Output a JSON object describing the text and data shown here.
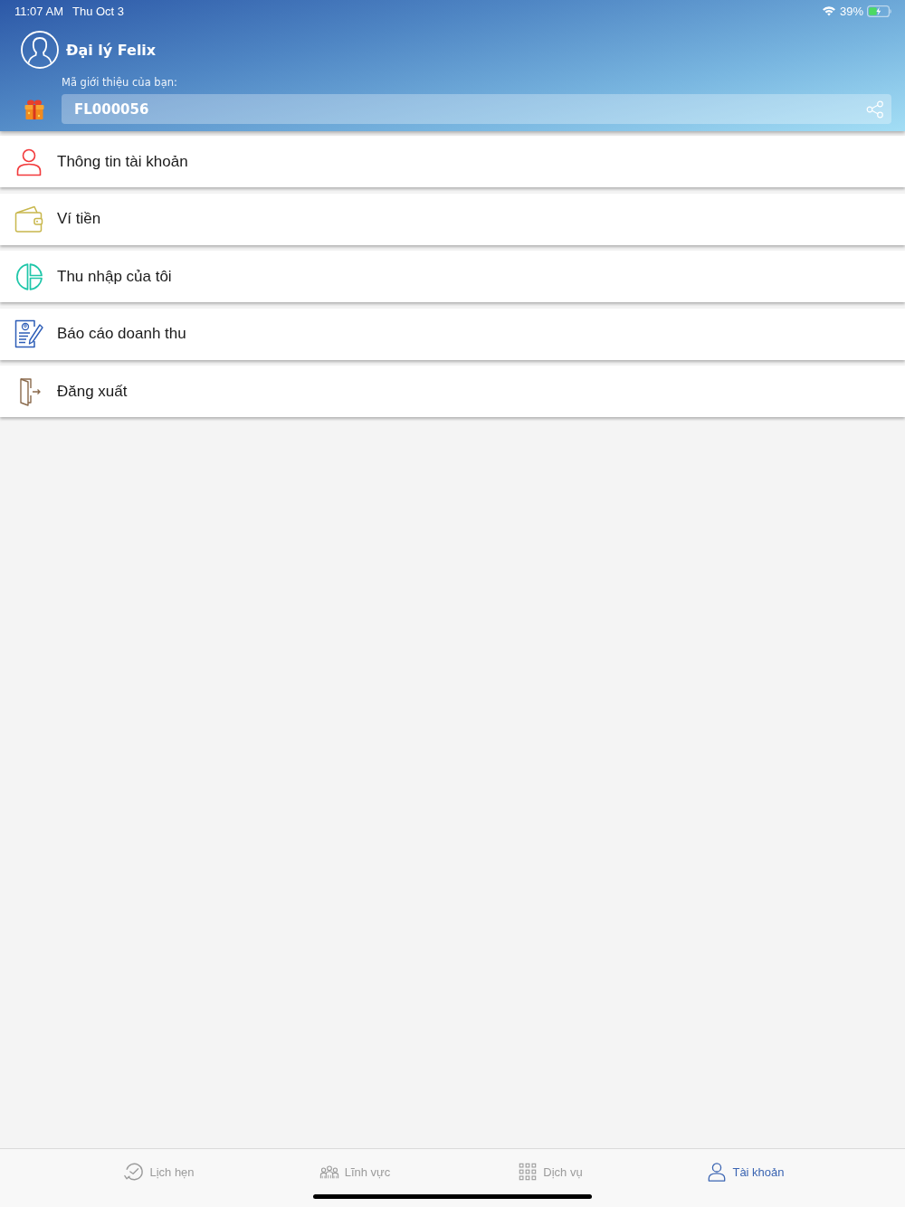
{
  "status_bar": {
    "time": "11:07 AM",
    "date": "Thu Oct 3",
    "battery_percent": "39%"
  },
  "profile": {
    "name": "Đại lý Felix",
    "referral_label": "Mã giới thiệu của bạn:",
    "referral_code": "FL000056"
  },
  "menu": [
    {
      "label": "Thông tin tài khoản",
      "kind": "account"
    },
    {
      "label": "Ví tiền",
      "kind": "wallet"
    },
    {
      "label": "Thu nhập của tôi",
      "kind": "income"
    },
    {
      "label": "Báo cáo doanh thu",
      "kind": "report"
    },
    {
      "label": "Đăng xuất",
      "kind": "logout"
    }
  ],
  "tabs": [
    {
      "label": "Lịch hẹn",
      "kind": "schedule",
      "selected": false
    },
    {
      "label": "Lĩnh vực",
      "kind": "fields",
      "selected": false
    },
    {
      "label": "Dịch vụ",
      "kind": "services",
      "selected": false
    },
    {
      "label": "Tài khoản",
      "kind": "account",
      "selected": true
    }
  ]
}
